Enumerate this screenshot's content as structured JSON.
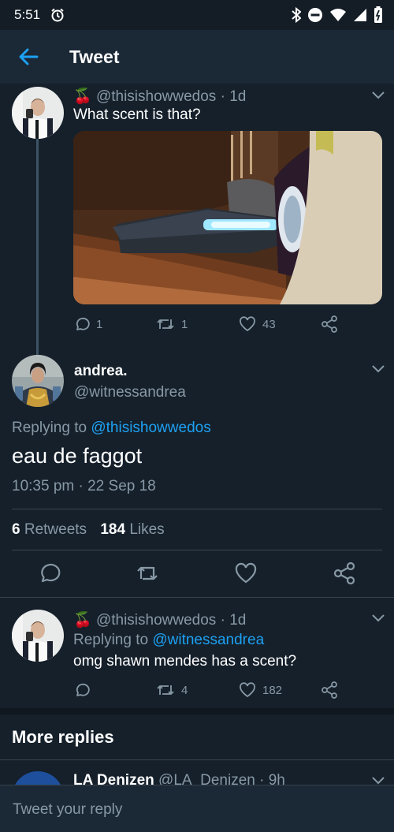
{
  "status_bar": {
    "time": "5:51"
  },
  "app_bar": {
    "title": "Tweet"
  },
  "parent_tweet": {
    "emoji": "🍒",
    "handle": "@thisishowwedos",
    "time": "· 1d",
    "text": "What scent is that?",
    "replies": "1",
    "retweets": "1",
    "likes": "43"
  },
  "main_tweet": {
    "name": "andrea.",
    "handle": "@witnessandrea",
    "replying_prefix": "Replying to",
    "replying_to": "@thisishowwedos",
    "text": "eau de faggot",
    "timestamp": "10:35 pm · 22 Sep 18",
    "retweets_count": "6",
    "retweets_label": "Retweets",
    "likes_count": "184",
    "likes_label": "Likes"
  },
  "reply_tweet": {
    "emoji": "🍒",
    "handle": "@thisishowwedos",
    "time": "· 1d",
    "replying_prefix": "Replying to",
    "replying_to": "@witnessandrea",
    "text": "omg shawn mendes has a scent?",
    "retweets": "4",
    "likes": "182"
  },
  "more_replies": {
    "heading": "More replies",
    "first": {
      "name": "LA Denizen",
      "handle": "@LA_Denizen",
      "time": "· 9h"
    }
  },
  "compose": {
    "placeholder": "Tweet your reply"
  },
  "colors": {
    "background": "#15202b",
    "bar": "#1b2836",
    "accent": "#1da1f2",
    "muted": "#8899a6"
  }
}
